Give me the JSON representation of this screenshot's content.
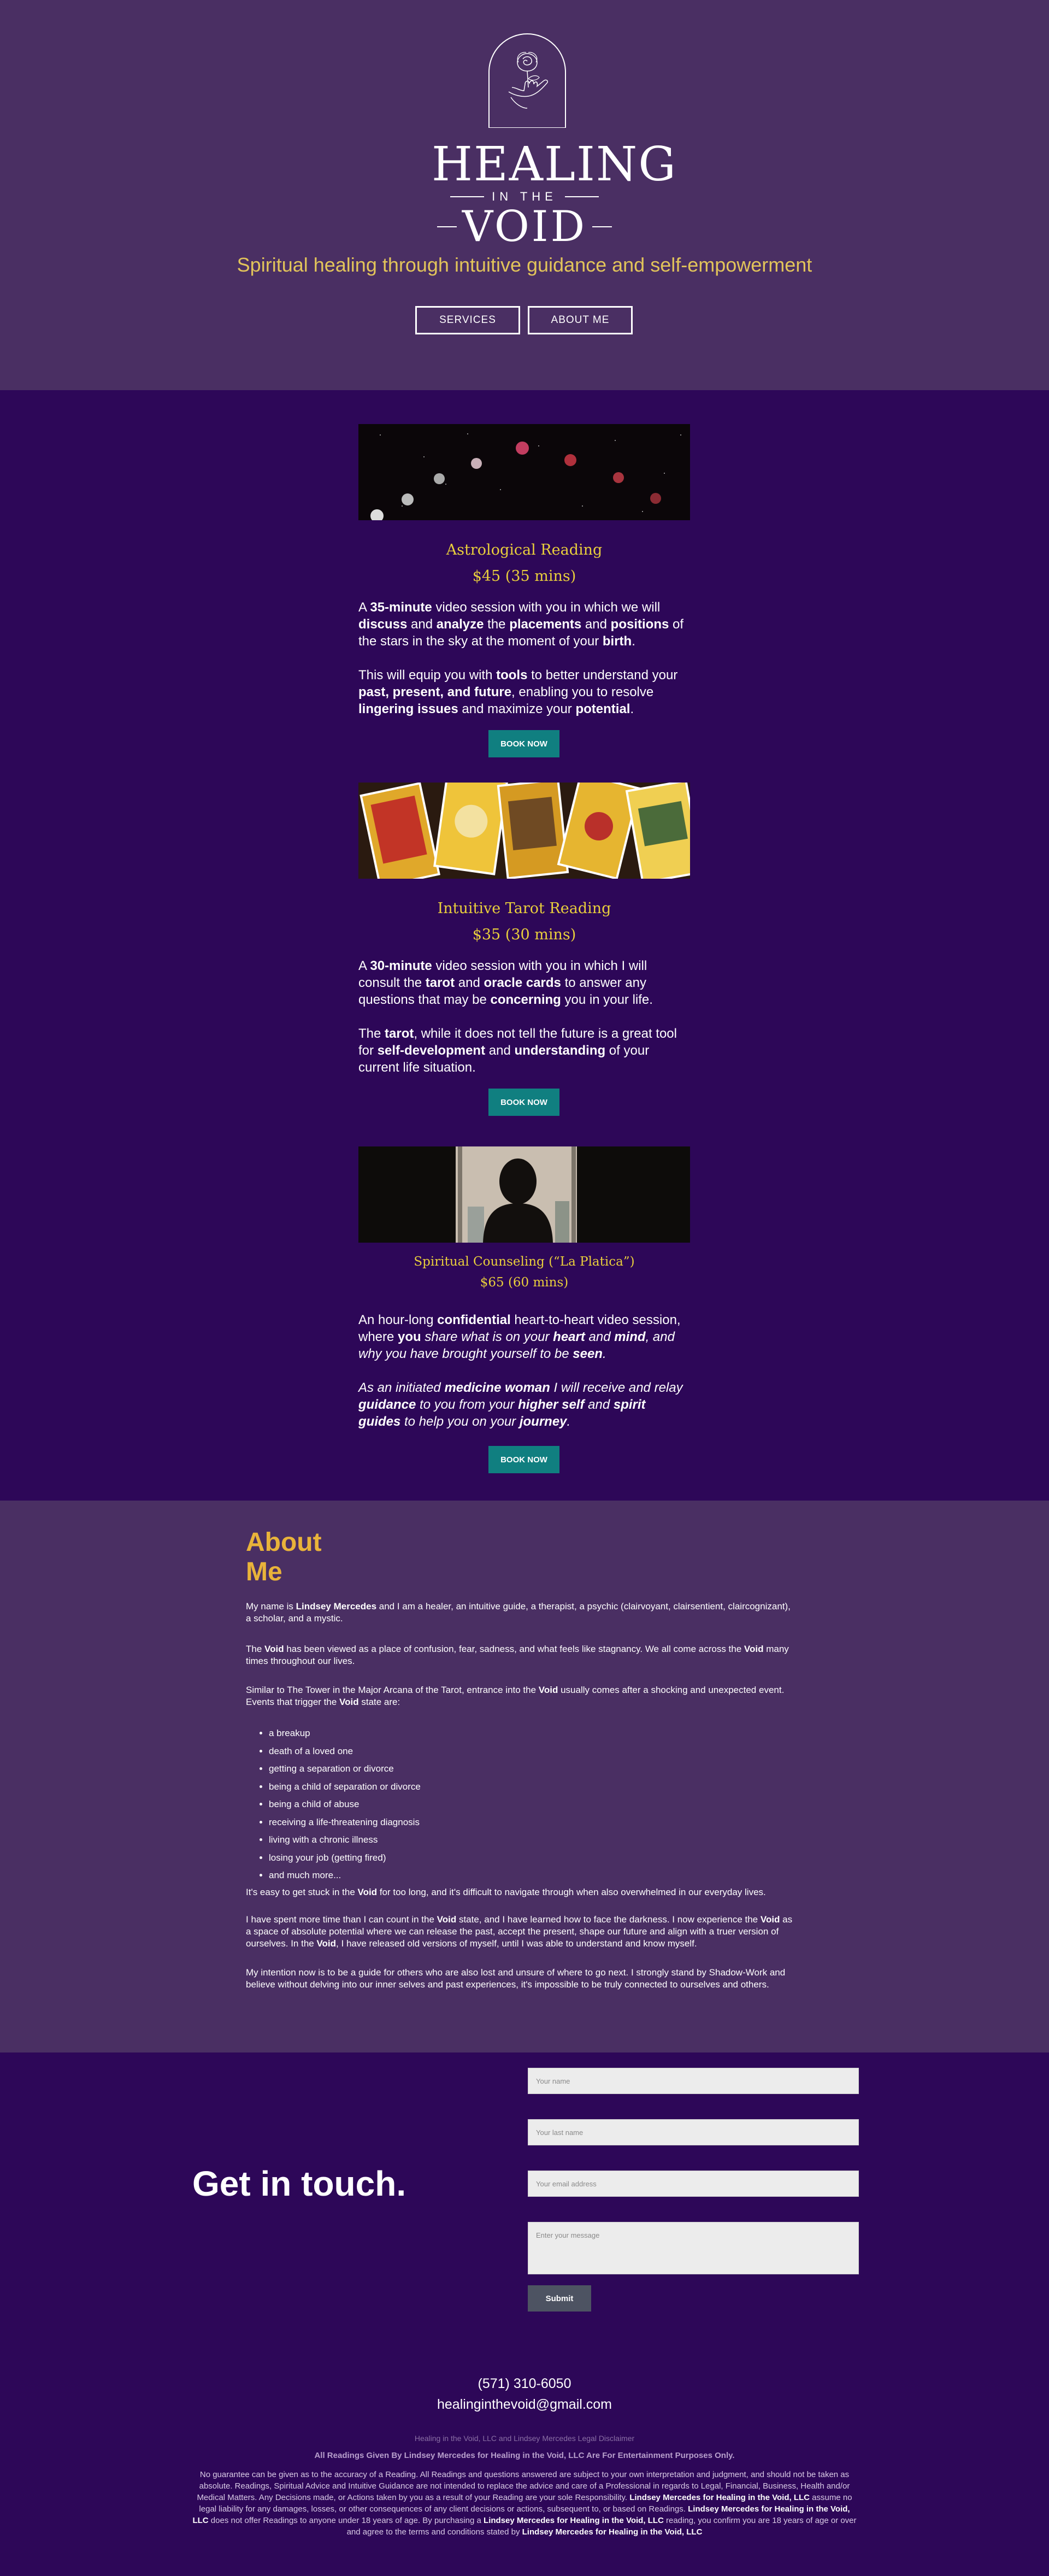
{
  "hero": {
    "brand_top": "HEALING",
    "brand_mid": "IN THE",
    "brand_bottom": "VOID",
    "tagline": "Spiritual healing through intuitive guidance and self-empowerment",
    "buttons": [
      "SERVICES",
      "ABOUT ME"
    ]
  },
  "services": [
    {
      "title": "Astrological Reading",
      "price": "$45 (35 mins)",
      "book": "BOOK NOW",
      "image_icon": "moon-phases-image"
    },
    {
      "title": "Intuitive Tarot Reading",
      "price": "$35 (30 mins)",
      "book": "BOOK NOW",
      "image_icon": "tarot-cards-image"
    },
    {
      "title": "Spiritual Counseling (“La Platica”)",
      "price": "$65 (60 mins)",
      "book": "BOOK NOW",
      "image_icon": "silhouette-window-image"
    }
  ],
  "service_text": {
    "s1p1": [
      "A ",
      "35-minute",
      " video session with you in which we will ",
      "discuss",
      " and ",
      "analyze",
      " the ",
      "placements",
      " and ",
      "positions",
      " of the stars in the sky at the moment of your ",
      "birth",
      "."
    ],
    "s1p2": [
      "This will equip you with ",
      "tools",
      " to better understand your ",
      "past, present, and future",
      ", enabling you to resolve ",
      "lingering issues",
      " and maximize your ",
      "potential",
      "."
    ],
    "s2p1": [
      "A ",
      "30-minute",
      " video session with you in which I will consult the ",
      "tarot",
      " and ",
      "oracle cards",
      " to answer any questions that may be ",
      "concerning",
      " you in your life."
    ],
    "s2p2": [
      "The ",
      "tarot",
      ", while it does not tell the future is a great tool for ",
      "self-development",
      " and ",
      "understanding",
      " of your current life situation."
    ],
    "s3p1": [
      "An hour-long ",
      "confidential",
      " heart-to-heart video session, where ",
      "you",
      " share what is on your ",
      "heart",
      " and ",
      "mind",
      ", and why you have brought yourself to be ",
      "seen",
      "."
    ],
    "s3p2": [
      "As an initiated ",
      "medicine woman",
      " I will receive and relay ",
      "guidance",
      " to you from your ",
      "higher self",
      " and ",
      "spirit guides",
      " to help you on your ",
      "journey",
      "."
    ]
  },
  "about": {
    "title_line1": "About",
    "title_line2": "Me",
    "p1": [
      "My name is ",
      "Lindsey Mercedes",
      " and I am a healer, an intuitive guide, a therapist, a psychic (clairvoyant, clairsentient, claircognizant), a scholar, and a mystic."
    ],
    "p2": [
      "The ",
      "Void",
      " has been viewed as a place of confusion, fear, sadness, and what feels like stagnancy. We all come across the ",
      "Void",
      " many times throughout our lives."
    ],
    "p3": [
      "Similar to The Tower in the Major Arcana of the Tarot, entrance into the ",
      "Void",
      " usually comes after a shocking and unexpected event. Events that trigger the ",
      "Void",
      " state are:"
    ],
    "list": [
      "a breakup",
      "death of a loved one",
      "getting a separation or divorce",
      "being a child of separation or divorce",
      "being a child of abuse",
      "receiving a life-threatening diagnosis",
      "living with a chronic illness",
      "losing your job (getting fired)",
      "and much more..."
    ],
    "p4": [
      "It's easy to get stuck in the ",
      "Void",
      " for too long, and it's difficult to navigate through when also overwhelmed in our everyday lives."
    ],
    "p5": [
      "I have spent more time than I can count in the ",
      "Void",
      " state, and I have learned how to face the darkness. I now experience the ",
      "Void",
      " as a space of absolute potential where we can release the past, accept the present, shape our future and align with a truer version of ourselves. In the ",
      "Void",
      ", I have released old versions of myself, until I was able to understand and know myself."
    ],
    "p6": [
      "My intention now is to be a guide for others who are also lost and unsure of where to go next. I strongly stand by Shadow-Work and believe without delving into our inner selves and past experiences, it's impossible to be truly connected to ourselves and others."
    ]
  },
  "contact": {
    "heading": "Get in touch.",
    "fields": [
      "Your name",
      "Your last name",
      "Your email address",
      "Enter your message"
    ],
    "submit": "Submit",
    "phone": "(571) 310-6050",
    "email": "healinginthevoid@gmail.com",
    "disclaimer_title": "Healing in the Void, LLC and Lindsey Mercedes Legal Disclaimer",
    "disclaimer_head": "All Readings Given By Lindsey Mercedes for Healing in the Void, LLC Are For Entertainment Purposes Only.",
    "disclaimer_body": [
      "No guarantee can be given as to the accuracy of a Reading. All Readings and questions answered are subject to your own interpretation and judgment, and should not be taken as absolute. Readings, Spiritual Advice and Intuitive Guidance are not intended to replace the advice and care of a Professional in regards to Legal, Financial, Business, Health and/or Medical Matters. Any Decisions made, or Actions taken by you as a result of your Reading are your sole Responsibility. ",
      "Lindsey Mercedes for Healing in the Void, LLC",
      " assume no legal liability for any damages, losses, or other consequences of any client decisions or actions, subsequent to, or based on Readings. ",
      "Lindsey Mercedes for Healing in the Void, LLC",
      " does not offer Readings to anyone under 18 years of age. By purchasing a ",
      "Lindsey Mercedes for Healing in the Void, LLC",
      " reading, you confirm you are 18 years of age or over and agree to the terms and conditions stated by ",
      "Lindsey Mercedes for Healing in the Void, LLC"
    ]
  },
  "colors": {
    "hero_bg": "#4a2f63",
    "dark_bg": "#2d0758",
    "gold": "#e9cf3c",
    "teal_button": "#107f80",
    "about_title": "#e9b33a"
  }
}
